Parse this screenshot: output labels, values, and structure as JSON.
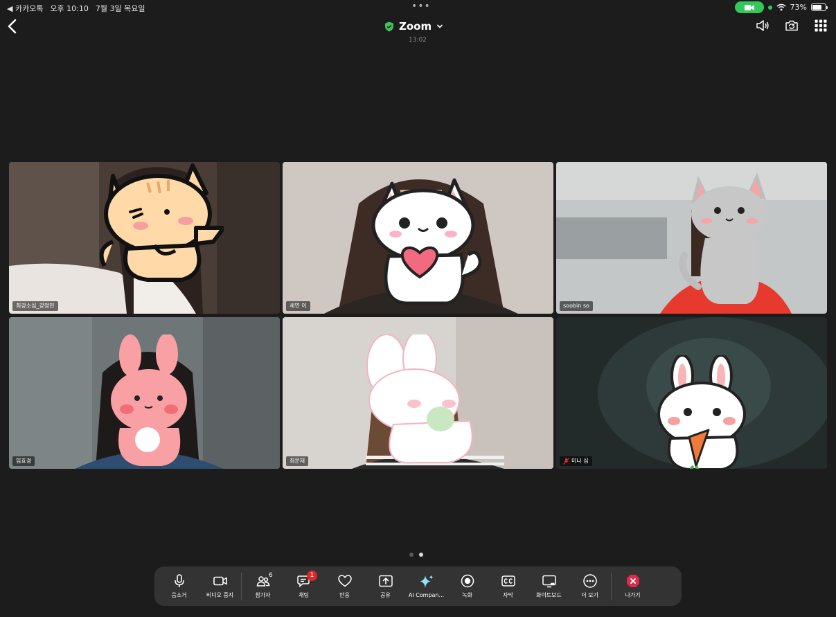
{
  "status_bar": {
    "back_app": "◀ 카카오톡",
    "time": "오후 10:10",
    "date": "7월 3일 목요일",
    "battery": "73%",
    "battery_level": 0.73
  },
  "header": {
    "title": "Zoom",
    "elapsed": "13:02"
  },
  "participants": [
    {
      "name": "최강소심_강정민",
      "speaking": false,
      "muted": false
    },
    {
      "name": "세연 이",
      "speaking": true,
      "muted": false
    },
    {
      "name": "soobin so",
      "speaking": false,
      "muted": false
    },
    {
      "name": "임효경",
      "speaking": false,
      "muted": false
    },
    {
      "name": "최문채",
      "speaking": false,
      "muted": false
    },
    {
      "name": "미나 심",
      "speaking": false,
      "muted": true
    }
  ],
  "pagination": {
    "pages": 2,
    "current": 2
  },
  "toolbar": {
    "mute": "음소거",
    "stop_video": "비디오 중지",
    "participants": "참가자",
    "participants_count": "6",
    "chat": "채팅",
    "chat_badge": "1",
    "react": "반응",
    "share": "공유",
    "ai_companion": "AI Compan...",
    "record": "녹화",
    "captions": "자막",
    "whiteboard": "화이트보드",
    "more": "더 보기",
    "leave": "나가기"
  },
  "colors": {
    "background": "#1c1c1c",
    "toolbar": "#333333",
    "active_speaker": "#3fc45b",
    "badge": "#e02828",
    "leave": "#e0284a",
    "shield": "#3fc45b"
  }
}
